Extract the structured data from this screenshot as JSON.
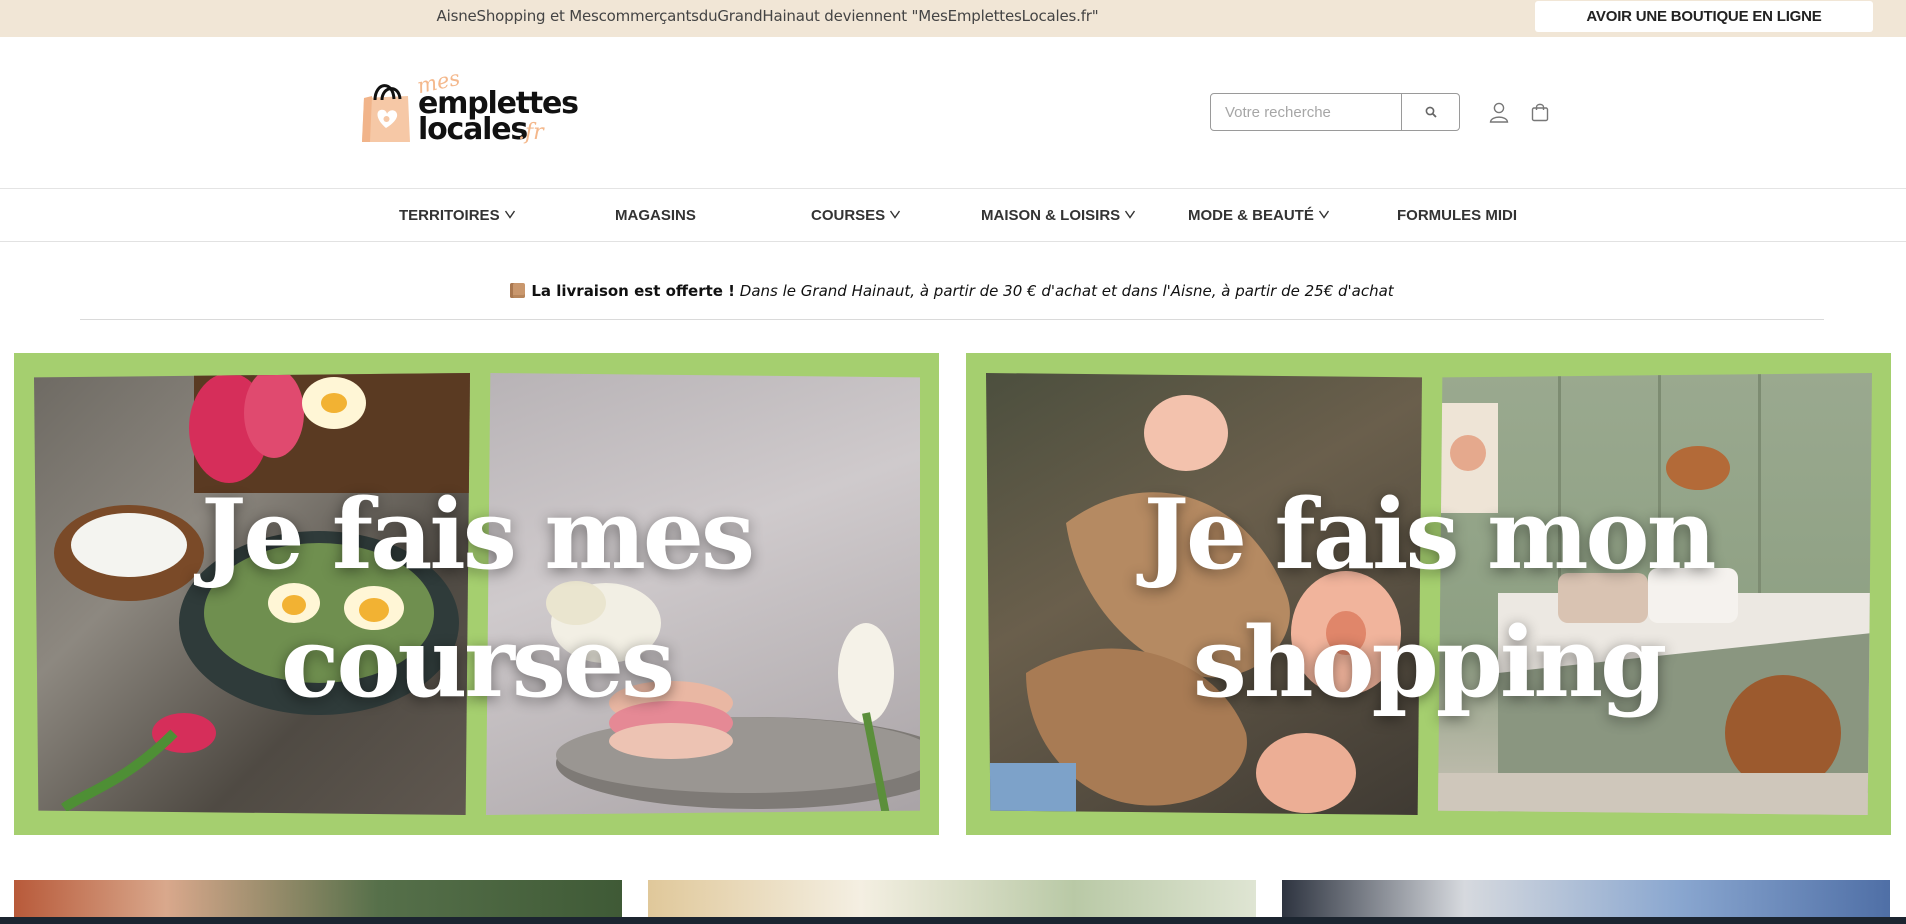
{
  "topbar": {
    "message": "AisneShopping et MescommerçantsduGrandHainaut deviennent \"MesEmplettesLocales.fr\"",
    "cta_label": "AVOIR UNE BOUTIQUE EN LIGNE"
  },
  "logo": {
    "word_mes": "mes",
    "word_emplettes": "emplettes",
    "word_locales": "locales",
    "word_fr": ".fr"
  },
  "search": {
    "placeholder": "Votre recherche",
    "value": ""
  },
  "header_icons": [
    "search-icon",
    "user-icon",
    "shopping-bag-icon"
  ],
  "nav": {
    "items": [
      {
        "label": "TERRITOIRES",
        "has_dropdown": true
      },
      {
        "label": "MAGASINS",
        "has_dropdown": false
      },
      {
        "label": "COURSES",
        "has_dropdown": true
      },
      {
        "label": "MAISON & LOISIRS",
        "has_dropdown": true
      },
      {
        "label": "MODE & BEAUTÉ",
        "has_dropdown": true
      },
      {
        "label": "FORMULES MIDI",
        "has_dropdown": false
      }
    ]
  },
  "notice": {
    "bold": "La livraison est offerte !",
    "italic": "Dans le Grand Hainaut, à partir de 30 € d'achat et dans l'Aisne, à partir de 25€ d'achat"
  },
  "banners": [
    {
      "line1": "Je fais mes",
      "line2": "courses"
    },
    {
      "line1": "Je fais mon",
      "line2": "shopping"
    }
  ],
  "colors": {
    "topbar_bg": "#f1e6d6",
    "banner_frame": "#a5cf6f",
    "logo_accent": "#f4b88c",
    "text_dark": "#222222"
  }
}
